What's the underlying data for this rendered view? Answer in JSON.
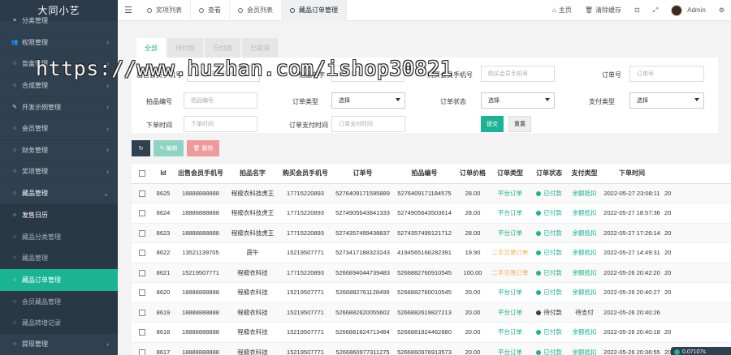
{
  "app": {
    "brand": "大同小艺"
  },
  "sidebar": {
    "items": [
      {
        "label": "分类管理",
        "icon": "list-icon",
        "glyph": "≡",
        "arrow": ""
      },
      {
        "label": "权限管理",
        "icon": "users-icon",
        "glyph": "👥",
        "arrow": "‹"
      },
      {
        "label": "盲盒管理",
        "icon": "circle-icon",
        "glyph": "○",
        "arrow": "‹"
      },
      {
        "label": "合成管理",
        "icon": "circle-icon",
        "glyph": "○",
        "arrow": "‹"
      },
      {
        "label": "开发示例管理",
        "icon": "pencil-icon",
        "glyph": "✎",
        "arrow": "‹"
      },
      {
        "label": "会员管理",
        "icon": "circle-icon",
        "glyph": "○",
        "arrow": "‹"
      },
      {
        "label": "财务管理",
        "icon": "circle-icon",
        "glyph": "○",
        "arrow": "‹"
      },
      {
        "label": "奖项管理",
        "icon": "circle-icon",
        "glyph": "○",
        "arrow": "‹"
      },
      {
        "label": "藏品管理",
        "icon": "circle-icon",
        "glyph": "○",
        "arrow": "⌄"
      }
    ],
    "subitems": [
      {
        "label": "发售日历",
        "icon": "circle-icon",
        "glyph": "○"
      },
      {
        "label": "藏品分类管理",
        "icon": "circle-icon",
        "glyph": "○"
      },
      {
        "label": "藏品管理",
        "icon": "circle-icon",
        "glyph": "○"
      },
      {
        "label": "藏品订单管理",
        "icon": "circle-icon",
        "glyph": "○"
      },
      {
        "label": "会员藏品管理",
        "icon": "circle-icon",
        "glyph": "○"
      },
      {
        "label": "藏品转增记录",
        "icon": "circle-icon",
        "glyph": "○"
      }
    ],
    "after": [
      {
        "label": "提现管理",
        "icon": "circle-icon",
        "glyph": "○",
        "arrow": "‹"
      }
    ]
  },
  "topbar": {
    "menu_glyph": "☰",
    "tabs": [
      {
        "label": "奖项列表"
      },
      {
        "label": "查看"
      },
      {
        "label": "会员列表"
      },
      {
        "label": "藏品订单管理"
      }
    ],
    "home_label": "主页",
    "home_glyph": "⌂",
    "clear_cache_label": "清除缓存",
    "clear_cache_glyph": "🗑",
    "user_name": "Admin"
  },
  "filters": {
    "tabs": [
      {
        "label": "全部"
      },
      {
        "label": "待付款"
      },
      {
        "label": "已付款"
      },
      {
        "label": "已取消"
      }
    ],
    "seller_phone_label": "出售会员手机号",
    "seller_phone_placeholder": "出售会员手机号",
    "item_name_label": "拍品名字",
    "item_name_placeholder": "拍品名字",
    "buyer_phone_label": "购买会员手机号",
    "buyer_phone_placeholder": "购买会员手机号",
    "order_no_label": "订单号",
    "order_no_placeholder": "订单号",
    "item_no_label": "拍品编号",
    "item_no_placeholder": "拍品编号",
    "order_type_label": "订单类型",
    "order_type_value": "选择",
    "order_status_label": "订单状态",
    "order_status_value": "选择",
    "pay_type_label": "支付类型",
    "pay_type_value": "选择",
    "order_time_label": "下单时间",
    "order_time_placeholder": "下单时间",
    "pay_time_label": "订单支付时间",
    "pay_time_placeholder": "订单支付时间",
    "submit_label": "提交",
    "reset_label": "重置"
  },
  "toolbar": {
    "refresh_glyph": "↻",
    "edit_label": "✎ 编辑",
    "delete_label": "🗑 删除"
  },
  "table": {
    "headers": [
      "",
      "Id",
      "出售会员手机号",
      "拍品名字",
      "购买会员手机号",
      "订单号",
      "拍品编号",
      "订单价格",
      "订单类型",
      "订单状态",
      "支付类型",
      "下单时间",
      ""
    ],
    "rows": [
      {
        "id": "8625",
        "seller": "18888888888",
        "name": "程瘊衣科技虎王",
        "buyer": "17715220893",
        "order": "5276409171595889",
        "item": "5276409171184575",
        "price": "28.00",
        "type": "平台订单",
        "type_kind": "plat",
        "status": "已付款",
        "status_kind": "paid",
        "pay": "余额抵扣",
        "pay_kind": "balance",
        "time": "2022-05-27 23:08:11",
        "extra": "20"
      },
      {
        "id": "8624",
        "seller": "18888888888",
        "name": "程瘊衣科技虎王",
        "buyer": "17715220893",
        "order": "5274905643841333",
        "item": "5274905643503614",
        "price": "28.00",
        "type": "平台订单",
        "type_kind": "plat",
        "status": "已付款",
        "status_kind": "paid",
        "pay": "余额抵扣",
        "pay_kind": "balance",
        "time": "2022-05-27 18:57:36",
        "extra": "20"
      },
      {
        "id": "8623",
        "seller": "18888888888",
        "name": "程瘊衣科技虎王",
        "buyer": "17715220893",
        "order": "5274357499438837",
        "item": "5274357499121712",
        "price": "28.00",
        "type": "平台订单",
        "type_kind": "plat",
        "status": "已付款",
        "status_kind": "paid",
        "pay": "余额抵扣",
        "pay_kind": "balance",
        "time": "2022-05-27 17:26:14",
        "extra": "20"
      },
      {
        "id": "8622",
        "seller": "13521139705",
        "name": "霞牛",
        "buyer": "15219507771",
        "order": "5273417188323243",
        "item": "4194565166282391",
        "price": "19.90",
        "type": "二手交易订单",
        "type_kind": "second",
        "status": "已付款",
        "status_kind": "paid",
        "pay": "余额抵扣",
        "pay_kind": "balance",
        "time": "2022-05-27 14:49:31",
        "extra": "20"
      },
      {
        "id": "8621",
        "seller": "15219507771",
        "name": "程瘊衣科技",
        "buyer": "17715220893",
        "order": "5266894044739483",
        "item": "5266882760910545",
        "price": "100.00",
        "type": "二手交易订单",
        "type_kind": "second",
        "status": "已付款",
        "status_kind": "paid",
        "pay": "余额抵扣",
        "pay_kind": "balance",
        "time": "2022-05-26 20:42:20",
        "extra": "20"
      },
      {
        "id": "8620",
        "seller": "18888888888",
        "name": "程瘊衣科技",
        "buyer": "15219507771",
        "order": "5266882761128499",
        "item": "5266882760010545",
        "price": "20.00",
        "type": "平台订单",
        "type_kind": "plat",
        "status": "已付款",
        "status_kind": "paid",
        "pay": "余额抵扣",
        "pay_kind": "balance",
        "time": "2022-05-26 20:40:27",
        "extra": "20"
      },
      {
        "id": "8619",
        "seller": "18888888888",
        "name": "程瘊衣科技",
        "buyer": "15219507771",
        "order": "5266882620055602",
        "item": "5266882619827213",
        "price": "20.00",
        "type": "平台订单",
        "type_kind": "plat",
        "status": "待付款",
        "status_kind": "pending",
        "pay": "待支付",
        "pay_kind": "pending",
        "time": "2022-05-26 20:40:26",
        "extra": ""
      },
      {
        "id": "8618",
        "seller": "18888888888",
        "name": "程瘊衣科技",
        "buyer": "15219507771",
        "order": "5266881824713484",
        "item": "5266881824462880",
        "price": "20.00",
        "type": "平台订单",
        "type_kind": "plat",
        "status": "已付款",
        "status_kind": "paid",
        "pay": "余额抵扣",
        "pay_kind": "balance",
        "time": "2022-05-26 20:40:18",
        "extra": "20"
      },
      {
        "id": "8617",
        "seller": "18888888888",
        "name": "程瘊衣科技",
        "buyer": "15219507771",
        "order": "5266860977311275",
        "item": "5266860976913573",
        "price": "20.00",
        "type": "平台订单",
        "type_kind": "plat",
        "status": "已付款",
        "status_kind": "paid",
        "pay": "余额抵扣",
        "pay_kind": "balance",
        "time": "2022-05-26 20:36:55",
        "extra": "20"
      }
    ]
  },
  "watermark": "https://www.huzhan.com/ishop30821",
  "badge": "0.07107s",
  "colors": {
    "sidebar": "#2f4050",
    "accent": "#1ab394",
    "warning": "#f0ad4e",
    "danger": "#ef9a9a"
  }
}
